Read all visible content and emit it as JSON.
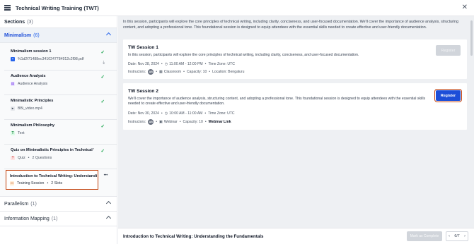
{
  "app": {
    "title": "Technical Writing Training (TWT)"
  },
  "sidebar": {
    "sections_label": "Sections",
    "sections_count": "(3)",
    "groups": [
      {
        "title": "Minimalism",
        "count": "(6)",
        "items": [
          {
            "title": "Minimalism session 1",
            "sub": "%1d2f71488ec3410247784912c2f98.pdf",
            "completed": true
          },
          {
            "title": "Audience Analysis",
            "sub": "Audience Analysis",
            "completed": true
          },
          {
            "title": "Minimalistic Principles",
            "sub": "BBi_video.mp4",
            "completed": true
          },
          {
            "title": "Minimalism Philosophy",
            "sub": "Text",
            "completed": true
          },
          {
            "title": "Quiz on Minimalistic Principles in Technical Wri...",
            "sub_type": "Quiz",
            "sub_detail": "2 Questions",
            "completed": true
          },
          {
            "title": "Introduction to Technical Writing: Understandin...",
            "sub_type": "Training Session",
            "sub_detail": "2 Slots",
            "selected": true
          }
        ]
      },
      {
        "title": "Parallelism",
        "count": "(1)"
      },
      {
        "title": "Information Mapping",
        "count": "(1)"
      }
    ]
  },
  "main": {
    "intro": "In this session, participants will explore the core principles of technical writing, including clarity, conciseness, and user-focused documentation. We'll cover the importance of audience analysis, structuring content, and adopting a professional tone. This foundational session is designed to equip attendees with the essential skills needed to create effective and user-friendly documentation.",
    "sessions": [
      {
        "title": "TW Session 1",
        "description": "In this session, participants will explore the core principles of technical writing, including clarity, conciseness, and user-focused documentation.",
        "date": "Date:  Nov 28, 2024",
        "time": "11:00 AM - 12:00 PM",
        "timezone": "Time Zone:  UTC",
        "instructors_label": "Instructors:",
        "avatar": "AB",
        "mode": "Classroom",
        "capacity": "Capacity:  10",
        "location": "Location:  Bengaluru",
        "register_label": "Register",
        "register_enabled": false
      },
      {
        "title": "TW Session 2",
        "description": "We'll cover the importance of audience analysis, structuring content, and adopting a professional tone. This foundational session is designed to equip attendees with the essential skills needed to create effective and user-friendly documentation.",
        "date": "Date:  Nov 30, 2024",
        "time": "10:00 AM - 11:00 AM",
        "timezone": "Time Zone:  UTC",
        "instructors_label": "Instructors:",
        "avatar": "AB",
        "mode": "Webinar",
        "capacity": "Capacity:  10",
        "location": "Webinar Link",
        "register_label": "Register",
        "register_enabled": true
      }
    ]
  },
  "footer": {
    "title": "Introduction to Technical Writing: Understanding the Fundamentals",
    "mark_complete": "Mark as Complete",
    "pager": "6/7"
  },
  "colors": {
    "accent": "#1d4ed8",
    "highlight": "#c2410c",
    "success": "#16a34a"
  }
}
